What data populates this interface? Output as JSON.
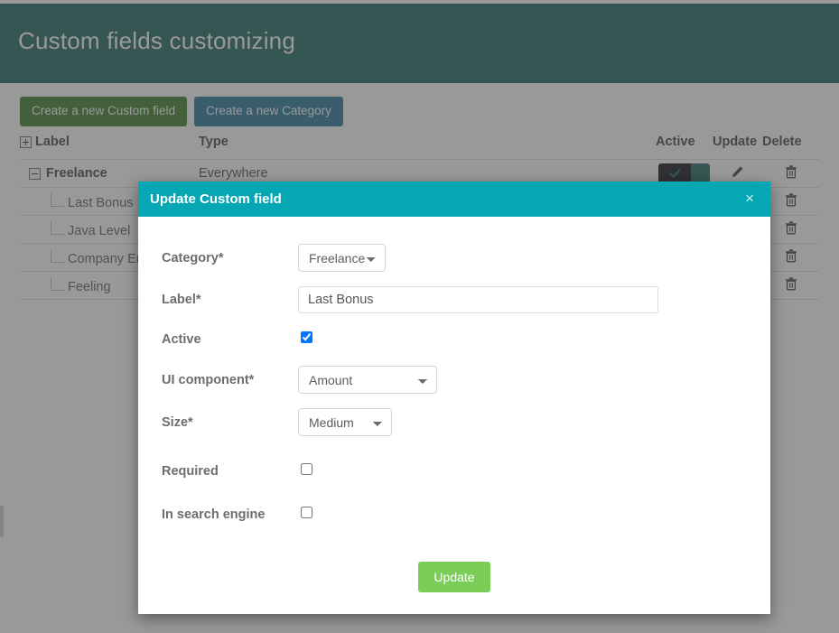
{
  "header": {
    "title": "Custom fields customizing",
    "bg_color": "#226b63"
  },
  "toolbar": {
    "create_custom_field_label": "Create a new Custom field",
    "create_category_label": "Create a new Category",
    "create_custom_field_color": "#41802f",
    "create_category_color": "#2b7b9b"
  },
  "table": {
    "columns": {
      "label": "Label",
      "type": "Type",
      "active": "Active",
      "update": "Update",
      "delete": "Delete"
    },
    "rows": [
      {
        "label": "Freelance",
        "type": "Everywhere",
        "kind": "category",
        "expanded": true,
        "active": true
      },
      {
        "label": "Last Bonus",
        "type": "",
        "kind": "field",
        "active": null
      },
      {
        "label": "Java Level",
        "type": "",
        "kind": "field",
        "active": null
      },
      {
        "label": "Company Email",
        "type": "",
        "kind": "field",
        "active": null
      },
      {
        "label": "Feeling",
        "type": "",
        "kind": "field",
        "active": null
      }
    ]
  },
  "modal": {
    "title": "Update Custom field",
    "close_label": "×",
    "header_color": "#06a7b4",
    "fields": {
      "category": {
        "label": "Category*",
        "value": "Freelance",
        "options": [
          "Freelance"
        ]
      },
      "label": {
        "label": "Label*",
        "value": "Last Bonus",
        "placeholder": ""
      },
      "active": {
        "label": "Active",
        "checked": true
      },
      "ui_component": {
        "label": "UI component*",
        "value": "Amount",
        "options": [
          "Amount"
        ]
      },
      "size": {
        "label": "Size*",
        "value": "Medium",
        "options": [
          "Medium"
        ]
      },
      "required": {
        "label": "Required",
        "checked": false
      },
      "in_search_engine": {
        "label": "In search engine",
        "checked": false
      }
    },
    "submit_label": "Update",
    "submit_color": "#7ace57"
  }
}
